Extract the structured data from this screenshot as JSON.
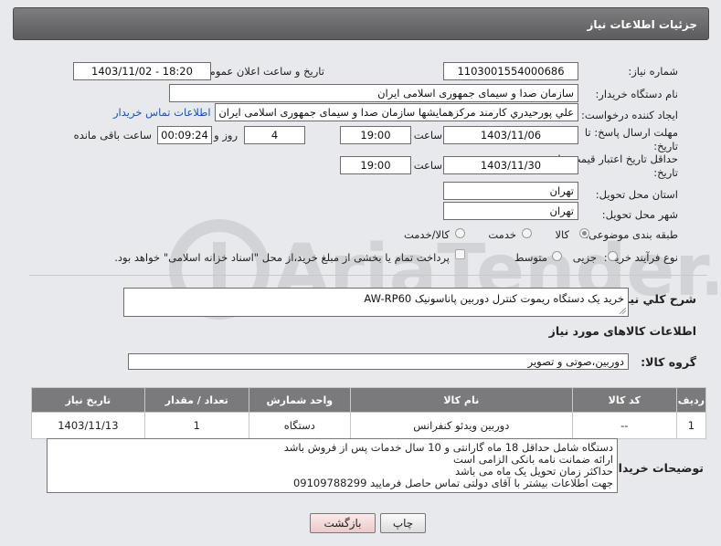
{
  "title": "جزئیات اطلاعات نیاز",
  "labels": {
    "need_number": "شماره نیاز:",
    "announce_datetime": "تاریخ و ساعت اعلان عمومی:",
    "buyer_org": "نام دستگاه خریدار:",
    "requester": "ایجاد کننده درخواست:",
    "reply_deadline": "مهلت ارسال پاسخ: تا تاریخ:",
    "hour": "ساعت",
    "days_and": "روز و",
    "hours_remaining": "ساعت باقی مانده",
    "price_validity": "حداقل تاریخ اعتبار قیمت: تا تاریخ:",
    "province": "استان محل تحویل:",
    "city": "شهر محل تحویل:",
    "subject_class": "طبقه بندی موضوعی:",
    "purchase_type": "نوع فرآیند خرید :",
    "need_summary": "شرح کلي نياز:",
    "goods_info": "اطلاعات کالاهای مورد نیاز",
    "goods_group": "گروه کالا:",
    "buyer_notes": "توضیحات خریدار:"
  },
  "fields": {
    "need_number": "1103001554000686",
    "announce_datetime": "1403/11/02 - 18:20",
    "buyer_org": "سازمان صدا و سیمای جمهوری اسلامی ایران",
    "requester": "علي پورحيدري کارمند مرکزهمایشها سازمان صدا و سیمای جمهوری اسلامی ایران",
    "contact_link": "اطلاعات تماس خریدار",
    "reply_date": "1403/11/06",
    "reply_time": "19:00",
    "days": "4",
    "remaining": "00:09:24",
    "validity_date": "1403/11/30",
    "validity_time": "19:00",
    "province": "تهران",
    "city": "تهران",
    "need_summary": "خرید یک دستگاه ریموت کنترل دوربین پاناسونیک AW-RP60",
    "goods_group": "دوربین،صوتی و تصویر"
  },
  "subject_options": [
    {
      "label": "کالا",
      "selected": true
    },
    {
      "label": "خدمت",
      "selected": false
    },
    {
      "label": "کالا/خدمت",
      "selected": false
    }
  ],
  "purchase_options": [
    {
      "label": "جزیی",
      "selected": false
    },
    {
      "label": "متوسط",
      "selected": false
    }
  ],
  "payment_note": "پرداخت تمام یا بخشی از مبلغ خرید،از محل \"اسناد خزانه اسلامی\" خواهد بود.",
  "table": {
    "headers": [
      "ردیف",
      "کد کالا",
      "نام کالا",
      "واحد شمارش",
      "تعداد / مقدار",
      "تاریخ نیاز"
    ],
    "rows": [
      [
        "1",
        "--",
        "دوربین ویدئو کنفرانس",
        "دستگاه",
        "1",
        "1403/11/13"
      ]
    ]
  },
  "notes": [
    "دستگاه شامل حداقل 18 ماه گارانتی و 10 سال خدمات پس از فروش باشد",
    "ارائه ضمانت نامه بانکی الزامی است",
    "حداکثر زمان تحویل یک ماه می باشد",
    "جهت اطلاعات بیشتر با آقای دولتی تماس حاصل فرمایید 09109788299"
  ],
  "buttons": {
    "print": "چاپ",
    "back": "بازگشت"
  },
  "watermark": "AriaTender.neT",
  "colors": {
    "header": "#6b6b6d",
    "link": "#1b52b5",
    "back_button": "#f4d7d7"
  }
}
